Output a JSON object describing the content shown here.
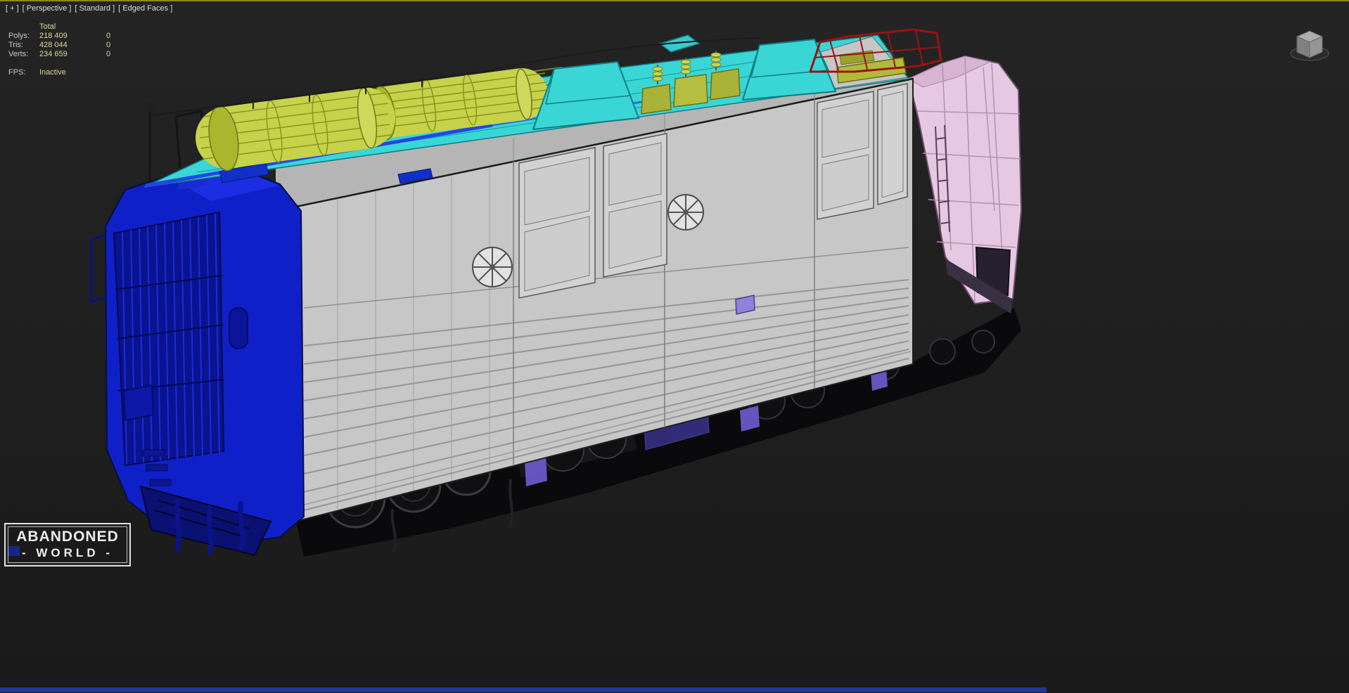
{
  "viewport_label": {
    "general": "[ + ]",
    "pov": "[ Perspective ]",
    "shading": "[ Standard ]",
    "mode": "[ Edged Faces ]"
  },
  "statistics": {
    "header": "Total",
    "rows": [
      {
        "label": "Polys:",
        "value": "218 409",
        "secondary": "0"
      },
      {
        "label": "Tris:",
        "value": "428 044",
        "secondary": "0"
      },
      {
        "label": "Verts:",
        "value": "234 659",
        "secondary": "0"
      }
    ],
    "fps": {
      "label": "FPS:",
      "value": "Inactive"
    }
  },
  "watermark": {
    "line1": "ABANDONED",
    "line2": "WORLD",
    "line2_prefix": "-",
    "line2_suffix": "-"
  },
  "icons": {
    "viewcube": "viewcube-3d-icon"
  },
  "colors": {
    "background": "#1e1e1e",
    "viewport_border_active": "#8a8a1a",
    "hud_text": "#dcdcdc",
    "stats_label": "#c9c9c9",
    "stats_value": "#d8d89c",
    "loco_gray": "#c7c7c7",
    "loco_gray_dark": "#b5b5b5",
    "loco_blue": "#1020c8",
    "loco_blue_dark": "#0a1390",
    "loco_blue_bright": "#2246e8",
    "loco_cyan": "#3ad6d6",
    "loco_cyan_dark": "#0d7d84",
    "loco_yellow": "#c6d24a",
    "loco_yellow_dark": "#8a941e",
    "loco_olive": "#b2ba3c",
    "loco_pink": "#e6c8e2",
    "loco_pink_dark": "#b292ae",
    "loco_red": "#9c1212",
    "loco_purple": "#6a58c8",
    "under_dark": "#0a0a0d",
    "track_blue": "#2038b0"
  }
}
